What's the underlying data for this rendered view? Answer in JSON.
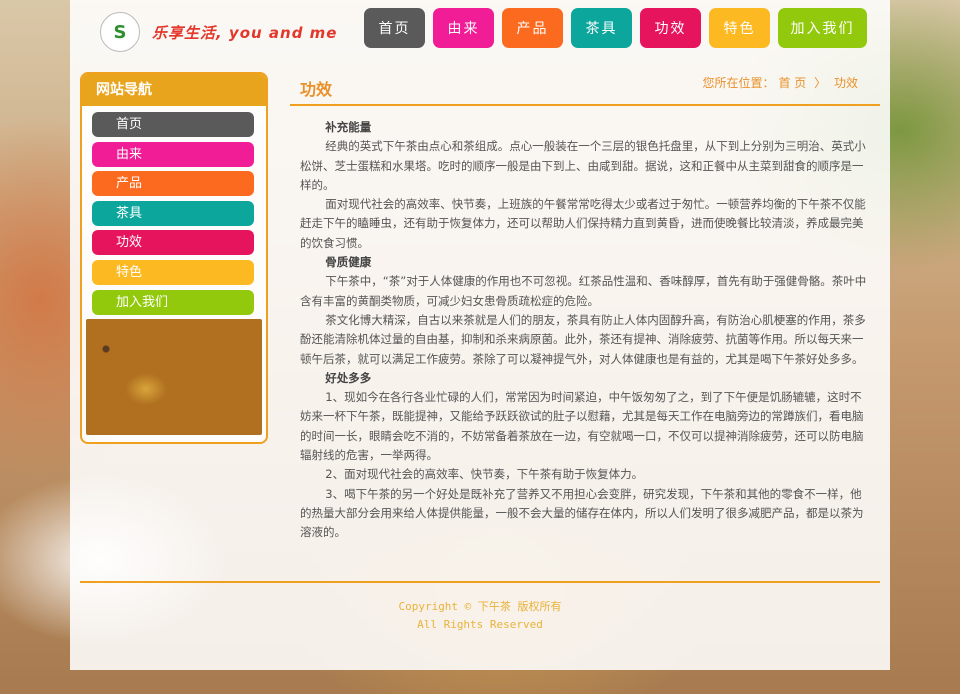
{
  "logo": {
    "mark": "S",
    "text": "乐享生活, you and me"
  },
  "topnav": [
    {
      "label": "首页",
      "color": "#5a5a5a",
      "w": 61
    },
    {
      "label": "由来",
      "color": "#f01d97",
      "w": 61
    },
    {
      "label": "产品",
      "color": "#fb6a1f",
      "w": 61
    },
    {
      "label": "茶具",
      "color": "#0da69c",
      "w": 61
    },
    {
      "label": "功效",
      "color": "#e6135d",
      "w": 61
    },
    {
      "label": "特色",
      "color": "#fdb921",
      "w": 61
    },
    {
      "label": "加入我们",
      "color": "#93c90d",
      "w": 89
    }
  ],
  "sidebar": {
    "title": "网站导航",
    "items": [
      {
        "label": "首页",
        "color": "#5a5a5a"
      },
      {
        "label": "由来",
        "color": "#f01d97"
      },
      {
        "label": "产品",
        "color": "#fb6a1f"
      },
      {
        "label": "茶具",
        "color": "#0da69c"
      },
      {
        "label": "功效",
        "color": "#e6135d"
      },
      {
        "label": "特色",
        "color": "#fdb921"
      },
      {
        "label": "加入我们",
        "color": "#93c90d"
      }
    ]
  },
  "main": {
    "title": "功效",
    "breadcrumb": {
      "prefix": "您所在位置：",
      "home": "首 页",
      "sep": "〉",
      "current": "功效"
    },
    "paragraphs": [
      {
        "type": "sub",
        "text": "补充能量"
      },
      {
        "type": "p",
        "text": "经典的英式下午茶由点心和茶组成。点心一般装在一个三层的银色托盘里，从下到上分别为三明治、英式小松饼、芝士蛋糕和水果塔。吃时的顺序一般是由下到上、由咸到甜。据说，这和正餐中从主菜到甜食的顺序是一样的。"
      },
      {
        "type": "p",
        "text": "面对现代社会的高效率、快节奏，上班族的午餐常常吃得太少或者过于匆忙。一顿营养均衡的下午茶不仅能赶走下午的瞌睡虫，还有助于恢复体力，还可以帮助人们保持精力直到黄昏，进而使晚餐比较清淡，养成最完美的饮食习惯。"
      },
      {
        "type": "sub",
        "text": "骨质健康"
      },
      {
        "type": "p",
        "text": "下午茶中，“茶”对于人体健康的作用也不可忽视。红茶品性温和、香味醇厚，首先有助于强健骨骼。茶叶中含有丰富的黄酮类物质，可减少妇女患骨质疏松症的危险。"
      },
      {
        "type": "p",
        "text": "茶文化博大精深，自古以来茶就是人们的朋友，茶具有防止人体内固醇升高，有防治心肌梗塞的作用，茶多酚还能清除机体过量的自由基，抑制和杀来病原菌。此外，茶还有提神、消除疲劳、抗菌等作用。所以每天来一顿午后茶，就可以满足工作疲劳。茶除了可以凝神提气外，对人体健康也是有益的，尤其是喝下午茶好处多多。"
      },
      {
        "type": "sub",
        "text": "好处多多"
      },
      {
        "type": "p",
        "text": "1、现如今在各行各业忙碌的人们，常常因为时间紧迫，中午饭匆匆了之，到了下午便是饥肠辘辘，这时不妨来一杯下午茶，既能提神，又能给予跃跃欲试的肚子以慰藉，尤其是每天工作在电脑旁边的常蹲族们，看电脑的时间一长，眼睛会吃不消的，不妨常备着茶放在一边，有空就喝一口，不仅可以提神消除疲劳，还可以防电脑辐射线的危害，一举两得。"
      },
      {
        "type": "p",
        "text": "2、面对现代社会的高效率、快节奏，下午茶有助于恢复体力。"
      },
      {
        "type": "p",
        "text": "3、喝下午茶的另一个好处是既补充了营养又不用担心会变胖，研究发现，下午茶和其他的零食不一样，他的热量大部分会用来给人体提供能量，一般不会大量的储存在体内，所以人们发明了很多减肥产品，都是以茶为溶液的。"
      }
    ]
  },
  "footer": {
    "line1": "Copyright © 下午茶 版权所有",
    "line2": "All Rights Reserved"
  }
}
